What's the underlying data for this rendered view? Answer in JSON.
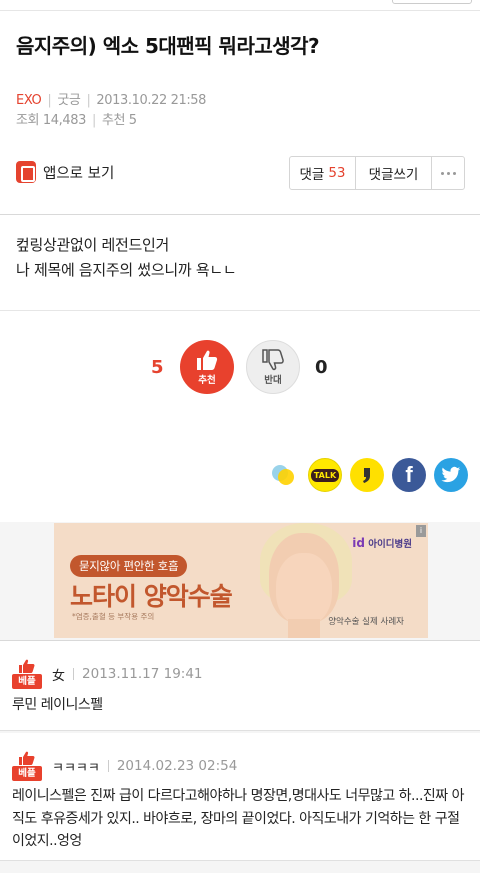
{
  "post": {
    "title": "음지주의) 엑소 5대팬픽 뭐라고생각?",
    "category": "EXO",
    "author": "굿긍",
    "date": "2013.10.22 21:58",
    "views_label": "조회",
    "views": "14,483",
    "recommend_label": "추천",
    "recommend": "5",
    "body": [
      "컾링상관없이 레전드인거",
      "나 제목에 음지주의 썼으니까 욕ㄴㄴ"
    ]
  },
  "toolbar": {
    "app_label": "앱으로 보기",
    "comments_label": "댓글",
    "comments_count": "53",
    "write_label": "댓글쓰기"
  },
  "vote": {
    "up_count": "5",
    "up_label": "추천",
    "down_count": "0",
    "down_label": "반대"
  },
  "share": [
    "kakaostory-icon",
    "kakaotalk-icon",
    "yellow-share-icon",
    "facebook-icon",
    "twitter-icon"
  ],
  "ad": {
    "tag": "묻지않아 편안한 호흡",
    "headline": "노타이 양악수술",
    "note": "*염증,출혈 등 부작용 주의",
    "logo_brand": "id",
    "logo_text": "아이디병원",
    "caption": "양악수술 실제 사례자"
  },
  "comments": [
    {
      "badge": "베플",
      "name": "女",
      "date": "2013.11.17 19:41",
      "text": "루민 레이니스펠"
    },
    {
      "badge": "베플",
      "name": "ㅋㅋㅋㅋ",
      "date": "2014.02.23 02:54",
      "text": "레이니스펠은 진짜 급이 다르다고해야하나 명장면,명대사도 너무많고 하...진짜 아직도 후유증세가 있지.. 바야흐로, 장마의 끝이었다. 아직도내가 기억하는 한 구절이었지..엉엉"
    }
  ],
  "colors": {
    "accent": "#e5432f",
    "facebook": "#3b5998",
    "twitter": "#2aa2e3",
    "kakao": "#ffe800"
  }
}
